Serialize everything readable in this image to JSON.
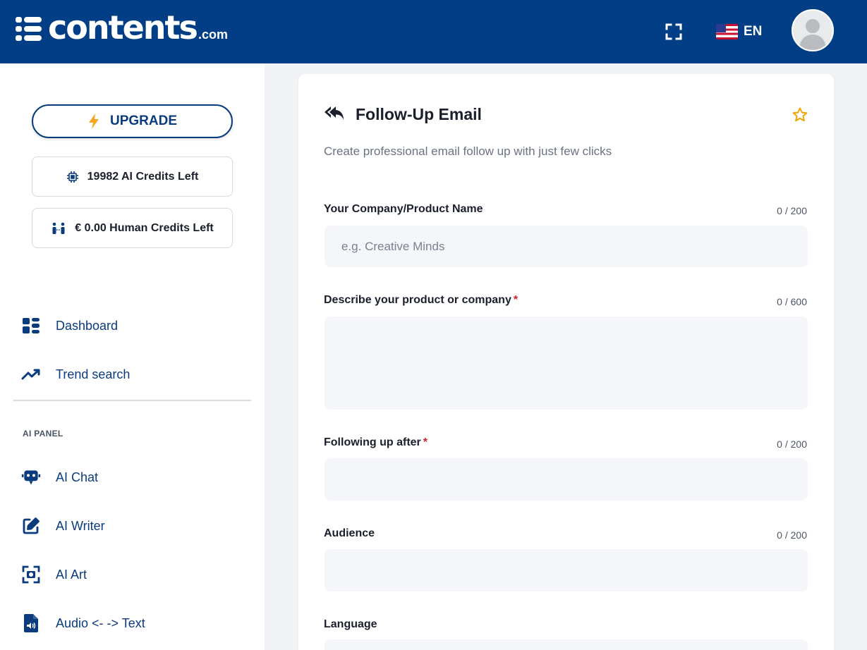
{
  "header": {
    "logo_text": "contents",
    "logo_suffix": ".com",
    "language": "EN"
  },
  "sidebar": {
    "upgrade_label": "UPGRADE",
    "ai_credits": "19982 AI Credits Left",
    "human_credits": "€ 0.00 Human Credits Left",
    "nav": [
      {
        "label": "Dashboard",
        "icon": "dashboard-icon"
      },
      {
        "label": "Trend search",
        "icon": "trend-icon"
      }
    ],
    "section_title": "AI PANEL",
    "ai_panel": [
      {
        "label": "AI Chat",
        "icon": "robot-icon"
      },
      {
        "label": "AI Writer",
        "icon": "edit-icon"
      },
      {
        "label": "AI Art",
        "icon": "camera-icon"
      },
      {
        "label": "Audio <- -> Text",
        "icon": "audio-file-icon"
      }
    ]
  },
  "form": {
    "title": "Follow-Up Email",
    "subtitle": "Create professional email follow up with just few clicks",
    "fields": [
      {
        "label": "Your Company/Product Name",
        "required": false,
        "counter": "0 / 200",
        "placeholder": "e.g. Creative Minds",
        "value": ""
      },
      {
        "label": "Describe your product or company",
        "required": true,
        "counter": "0 / 600",
        "placeholder": "",
        "value": ""
      },
      {
        "label": "Following up after",
        "required": true,
        "counter": "0 / 200",
        "placeholder": "",
        "value": ""
      },
      {
        "label": "Audience",
        "required": false,
        "counter": "0 / 200",
        "placeholder": "",
        "value": ""
      },
      {
        "label": "Language",
        "required": false
      }
    ]
  },
  "colors": {
    "header_bg": "#013e86",
    "primary": "#0a3b7c",
    "accent_star": "#f0a500",
    "upgrade_bolt": "#f5a623",
    "required": "#d0202e",
    "input_bg": "#f4f6f9"
  }
}
